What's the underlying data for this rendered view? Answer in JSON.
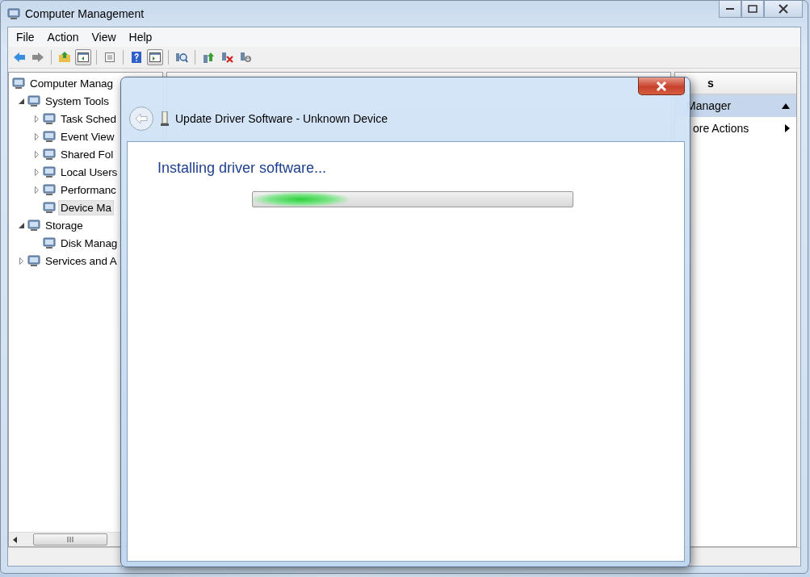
{
  "window": {
    "title": "Computer Management"
  },
  "menu": [
    "File",
    "Action",
    "View",
    "Help"
  ],
  "toolbar": [
    {
      "kind": "back",
      "on": false
    },
    {
      "kind": "forward",
      "on": false
    },
    {
      "kind": "separator"
    },
    {
      "kind": "up",
      "on": false
    },
    {
      "kind": "tree",
      "on": true
    },
    {
      "kind": "separator"
    },
    {
      "kind": "properties",
      "on": false
    },
    {
      "kind": "separator"
    },
    {
      "kind": "help",
      "on": false
    },
    {
      "kind": "panel",
      "on": true
    },
    {
      "kind": "separator"
    },
    {
      "kind": "scan",
      "on": false
    },
    {
      "kind": "separator"
    },
    {
      "kind": "update",
      "on": false
    },
    {
      "kind": "uninstall",
      "on": false
    },
    {
      "kind": "disable",
      "on": false
    }
  ],
  "tree": [
    {
      "label": "Computer Manag",
      "kind": "root",
      "selected": false,
      "children": [
        {
          "label": "System Tools",
          "kind": "branch",
          "expanded": true,
          "selected": false,
          "children": [
            {
              "label": "Task Sched",
              "kind": "branch",
              "expanded": false,
              "selected": false
            },
            {
              "label": "Event View",
              "kind": "branch",
              "expanded": false,
              "selected": false
            },
            {
              "label": "Shared Fol",
              "kind": "branch",
              "expanded": false,
              "selected": false
            },
            {
              "label": "Local Users",
              "kind": "branch",
              "expanded": false,
              "selected": false
            },
            {
              "label": "Performanc",
              "kind": "branch",
              "expanded": false,
              "selected": false
            },
            {
              "label": "Device Ma",
              "kind": "leaf",
              "selected": true
            }
          ]
        },
        {
          "label": "Storage",
          "kind": "branch",
          "expanded": true,
          "selected": false,
          "children": [
            {
              "label": "Disk Manag",
              "kind": "leaf",
              "selected": false
            }
          ]
        },
        {
          "label": "Services and A",
          "kind": "branch",
          "expanded": false,
          "selected": false
        }
      ]
    }
  ],
  "actions": {
    "header": "s",
    "items": [
      {
        "label": "Manager",
        "kind": "section"
      },
      {
        "label": "ore Actions",
        "kind": "submenu"
      }
    ]
  },
  "dialog": {
    "title": "Update Driver Software - Unknown Device",
    "heading": "Installing driver software...",
    "progress": {
      "level": 0.3
    }
  }
}
